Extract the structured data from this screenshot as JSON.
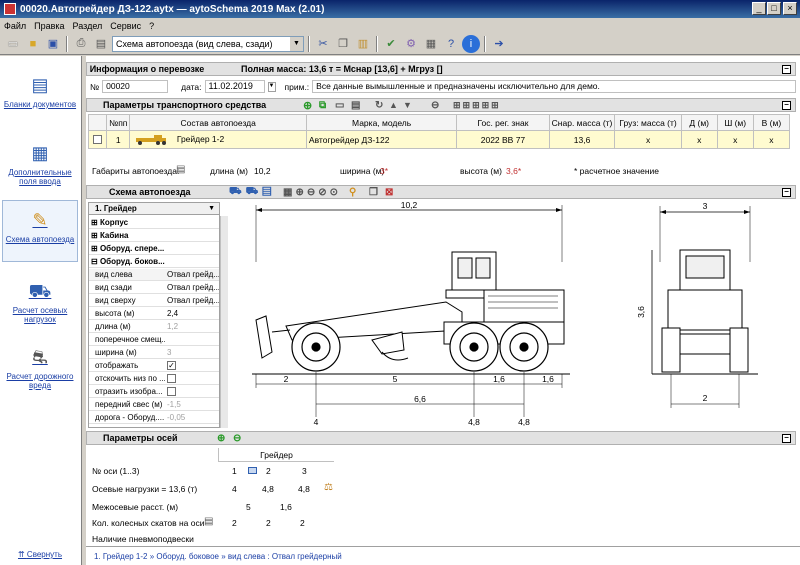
{
  "window": {
    "title": "00020.Автогрейдер ДЗ-122.aytx  —  aytoSchema 2019 Max (2.01)"
  },
  "menu": [
    "Файл",
    "Правка",
    "Раздел",
    "Сервис",
    "?"
  ],
  "toolbar": {
    "view_combo": "Схема автопоезда (вид слева, сзади)"
  },
  "sidebar": {
    "items": [
      {
        "label": "Бланки документов",
        "icon": "document-icon"
      },
      {
        "label": "Дополнительные поля ввода",
        "icon": "grid-icon"
      },
      {
        "label": "Схема автопоезда",
        "icon": "tools-icon"
      },
      {
        "label": "Расчет осевых нагрузок",
        "icon": "truck-icon"
      },
      {
        "label": "Расчет дорожного вреда",
        "icon": "road-icon"
      }
    ],
    "collapse_label": "Свернуть"
  },
  "info": {
    "header": "Информация о перевозке",
    "total_mass": "Полная масса: 13,6 т = Мснар [13,6] + Мгруз []",
    "num_label": "№",
    "num_value": "00020",
    "date_label": "дата:",
    "date_value": "11.02.2019",
    "note_label": "прим.:",
    "note_value": "Все данные вымышленные и предназначены исключительно для демо."
  },
  "params": {
    "header": "Параметры транспортного средства",
    "columns": [
      "№пп",
      "Состав автопоезда",
      "Марка, модель",
      "Гос. рег. знак",
      "Снар. масса (т)",
      "Груз: масса (т)",
      "Д (м)",
      "Ш (м)",
      "В (м)"
    ],
    "row": {
      "num": "1",
      "name": "Грейдер 1-2",
      "model": "Автогрейдер ДЗ-122",
      "plate": "2022 BB 77",
      "mass": "13,6",
      "cargo": "х",
      "d": "х",
      "w": "х",
      "h": "х"
    },
    "dims_label": "Габариты автопоезда:",
    "length_label": "длина (м)",
    "length_value": "10,2",
    "width_label": "ширина (м)",
    "width_value": "3*",
    "height_label": "высота (м)",
    "height_value": "3,6*",
    "calc_note": "* расчетное значение"
  },
  "scheme": {
    "header": "Схема автопоезда",
    "tree_root": "1. Грейдер",
    "groups": [
      "Корпус",
      "Кабина",
      "Оборуд. спере...",
      "Оборуд. боков..."
    ],
    "props": [
      {
        "k": "вид слева",
        "v": "Отвал грейд..."
      },
      {
        "k": "вид сзади",
        "v": "Отвал грейд..."
      },
      {
        "k": "вид сверху",
        "v": "Отвал грейд..."
      },
      {
        "k": "высота (м)",
        "v": "2,4"
      },
      {
        "k": "длина (м)",
        "v": "1,2"
      },
      {
        "k": "поперечное смещ...",
        "v": ""
      },
      {
        "k": "ширина (м)",
        "v": "3"
      },
      {
        "k": "отображать",
        "v": "✓"
      },
      {
        "k": "отскочить низ по ...",
        "v": ""
      },
      {
        "k": "отразить изобра...",
        "v": ""
      },
      {
        "k": "передний свес (м)",
        "v": "-1,5"
      },
      {
        "k": "дорога - Оборуд....",
        "v": "-0,05"
      }
    ],
    "dims": {
      "total": "10,2",
      "d1": "2",
      "d2": "5",
      "d3": "1,6",
      "d4": "1,6",
      "d5": "6,6",
      "a1": "4",
      "a2": "4,8",
      "a3": "4,8",
      "rear_width": "3",
      "rear_height": "3,6",
      "rear_track": "2"
    }
  },
  "axles": {
    "header": "Параметры осей",
    "vehicle": "Грейдер",
    "rows": [
      {
        "label": "№ оси (1..3)",
        "values": [
          "1",
          "2",
          "3"
        ]
      },
      {
        "label": "Осевые нагрузки  = 13,6 (т)",
        "values": [
          "4",
          "4,8",
          "4,8"
        ]
      },
      {
        "label": "Межосевые расст. (м)",
        "values": [
          "5",
          "1,6"
        ]
      },
      {
        "label": "Кол. колесных скатов на оси",
        "values": [
          "2",
          "2",
          "2"
        ]
      },
      {
        "label": "Наличие пневмоподвески",
        "values": []
      }
    ]
  },
  "status": {
    "path": "1. Грейдер 1-2  »  Оборуд. боковое  »  вид слева :  Отвал грейдерный"
  }
}
